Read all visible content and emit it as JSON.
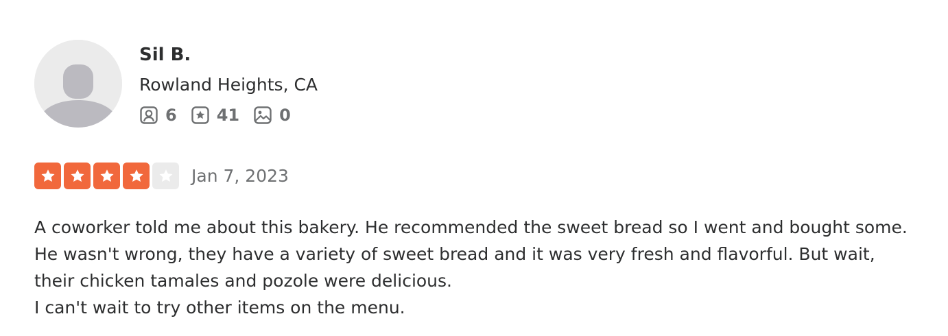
{
  "review": {
    "user": {
      "name": "Sil B.",
      "location": "Rowland Heights, CA",
      "stats": {
        "friends": "6",
        "reviews": "41",
        "photos": "0"
      }
    },
    "rating": {
      "stars": 4,
      "max_stars": 5,
      "color_on": "#f1683c",
      "color_off": "#ebebeb"
    },
    "date": "Jan 7, 2023",
    "text": {
      "paragraph_1": "A coworker told me about this bakery. He recommended the sweet bread so I went and bought some. He wasn't wrong, they have a variety of sweet bread and it was very fresh and flavorful. But wait, their chicken tamales and pozole were delicious.",
      "paragraph_2": "I can't wait to try other items on the menu."
    }
  },
  "icons": {
    "avatar": "default-user-avatar",
    "friends": "friends-icon",
    "reviews": "review-star-icon",
    "photos": "photo-icon",
    "star": "star-icon"
  }
}
